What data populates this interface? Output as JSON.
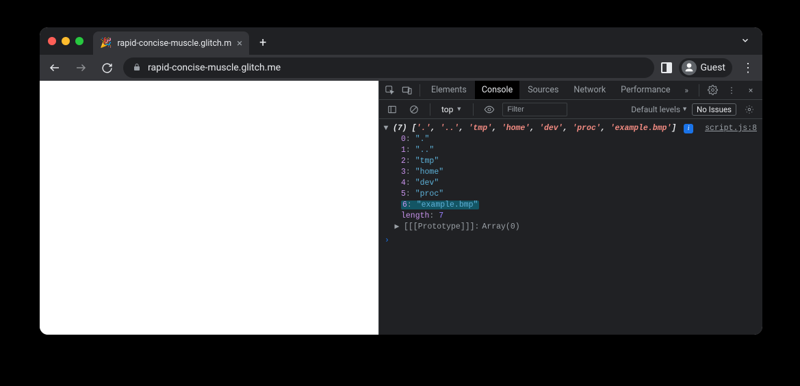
{
  "browser": {
    "tab_title": "rapid-concise-muscle.glitch.m",
    "favicon": "🎉",
    "url_display": "rapid-concise-muscle.glitch.me",
    "guest_label": "Guest"
  },
  "devtools": {
    "tabs": {
      "elements": "Elements",
      "console": "Console",
      "sources": "Sources",
      "network": "Network",
      "performance": "Performance"
    },
    "more_tabs_glyph": "»",
    "context": "top",
    "filter_placeholder": "Filter",
    "levels_label": "Default levels",
    "issues_label": "No Issues"
  },
  "console": {
    "count_label": "(7)",
    "preview_items": [
      "'.'",
      "'..'",
      "'tmp'",
      "'home'",
      "'dev'",
      "'proc'",
      "'example.bmp'"
    ],
    "source_link": "script.js:8",
    "entries": [
      {
        "index": "0",
        "value": "\".\""
      },
      {
        "index": "1",
        "value": "\"..\""
      },
      {
        "index": "2",
        "value": "\"tmp\""
      },
      {
        "index": "3",
        "value": "\"home\""
      },
      {
        "index": "4",
        "value": "\"dev\""
      },
      {
        "index": "5",
        "value": "\"proc\""
      },
      {
        "index": "6",
        "value": "\"example.bmp\"",
        "highlighted": true
      }
    ],
    "length_key": "length",
    "length_value": "7",
    "prototype_label": "[[Prototype]]",
    "prototype_value": "Array(0)"
  }
}
